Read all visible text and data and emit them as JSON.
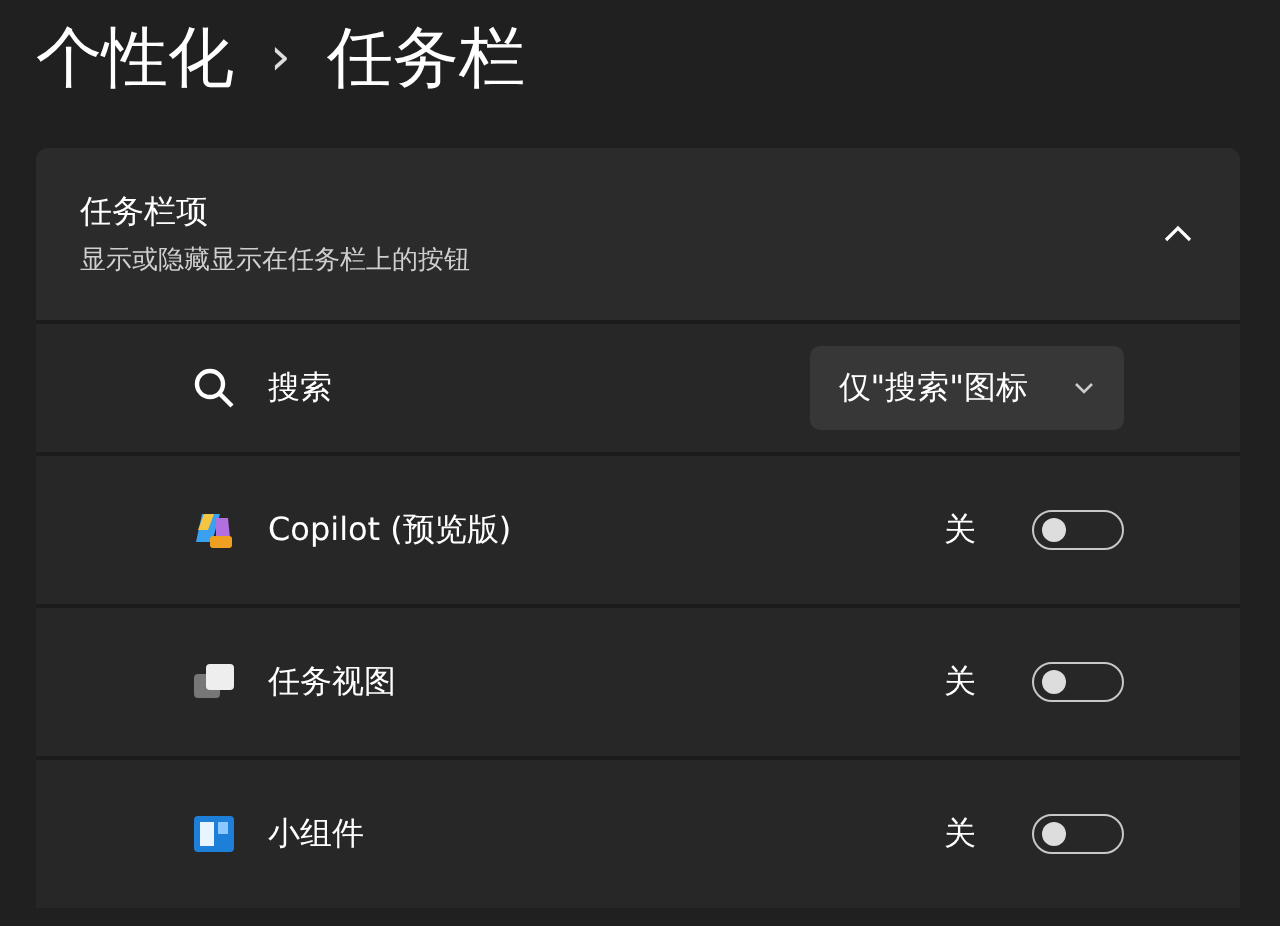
{
  "breadcrumb": [
    "个性化",
    "›",
    "任务栏"
  ],
  "section": {
    "title": "任务栏项",
    "subtitle": "显示或隐藏显示在任务栏上的按钮",
    "expanded": true,
    "items": [
      {
        "kind": "dropdown",
        "label": "搜索",
        "value": "仅\"搜索\"图标"
      },
      {
        "kind": "toggle",
        "label": "Copilot (预览版)",
        "state_text": "关",
        "on": false
      },
      {
        "kind": "toggle",
        "label": "任务视图",
        "state_text": "关",
        "on": false
      },
      {
        "kind": "toggle",
        "label": "小组件",
        "state_text": "关",
        "on": false
      }
    ]
  }
}
